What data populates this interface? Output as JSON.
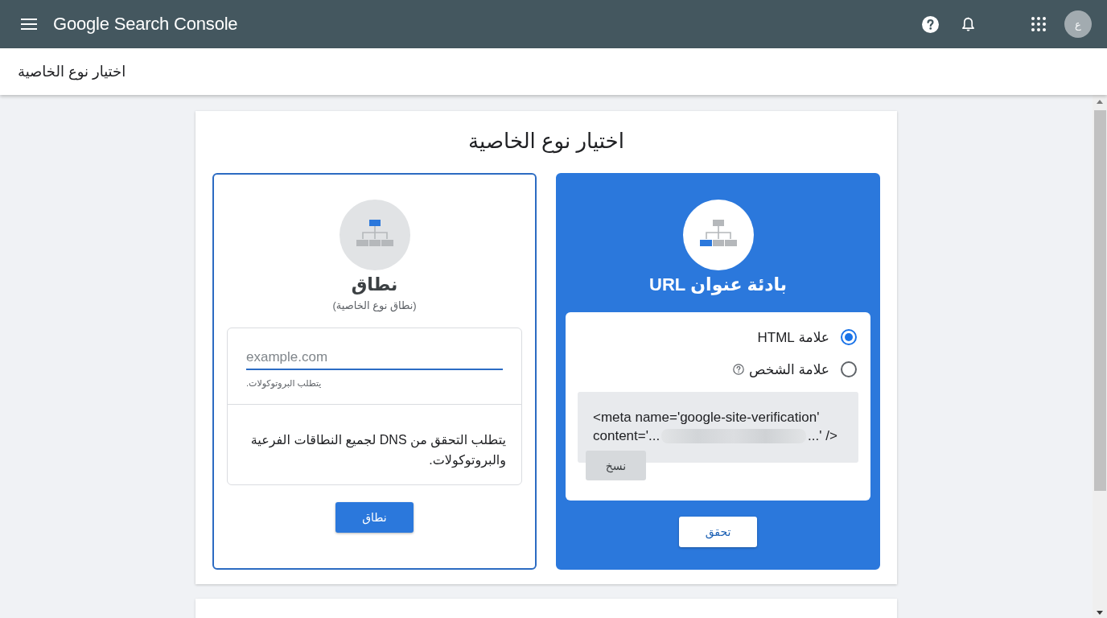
{
  "app_bar": {
    "title": "Google Search Console",
    "avatar": "ع"
  },
  "page_header": {
    "title": "اختيار نوع الخاصية"
  },
  "dialog": {
    "title": "اختيار نوع الخاصية",
    "options": [
      {
        "kind": "url_prefix",
        "selected": true,
        "title": "بادئة عنوان URL",
        "methods": [
          {
            "label": "علامة HTML",
            "selected": true,
            "help": false
          },
          {
            "label": "علامة الشخص",
            "selected": false,
            "help": true
          }
        ],
        "code": {
          "first_line": "<meta name='google-site-verification'",
          "value_prefix": "content='...",
          "value_suffix": "...' />"
        },
        "copy_button": "نسخ",
        "button": "تحقق"
      },
      {
        "kind": "domain",
        "selected": false,
        "title": "نطاق",
        "subtitle": "(نطاق نوع الخاصية)",
        "input": {
          "placeholder": "example.com",
          "helper": "يتطلب البروتوكولات."
        },
        "description": "يتطلب التحقق من DNS لجميع النطاقات الفرعية والبروتوكولات.",
        "button": "نطاق"
      }
    ]
  }
}
